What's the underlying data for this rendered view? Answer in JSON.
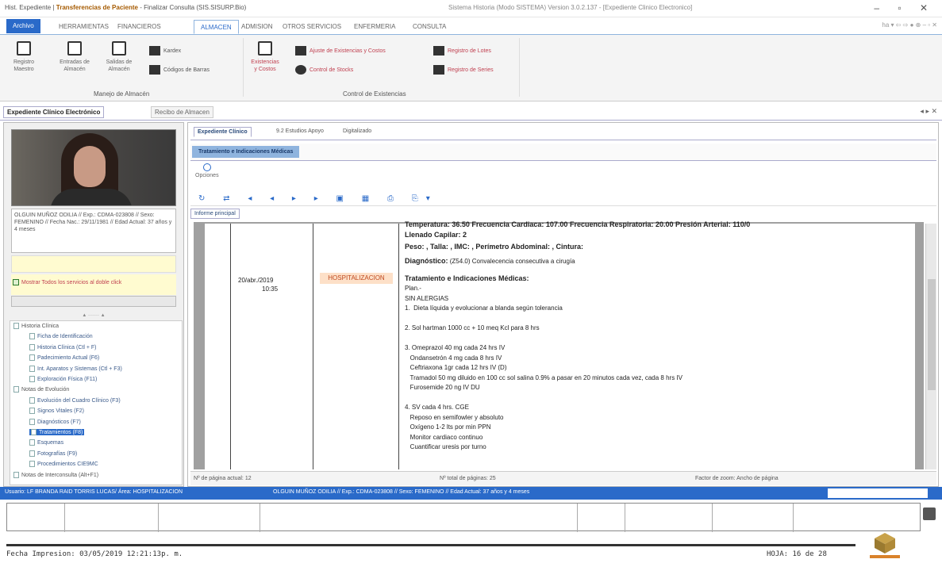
{
  "titlebar": {
    "left_prefix": "Hist. Expediente |",
    "left_bold": "Transferencias de Paciente",
    "left_suffix": "- Finalizar Consulta (SIS.SISURP.Bio)",
    "center": "Sistema Historia (Modo SISTEMA) Version 3.0.2.137 - [Expediente Clinico Electronico]",
    "controls": "– ▫ ✕"
  },
  "menubar": {
    "tabs": [
      "Archivo",
      "HERRAMIENTAS",
      "FINANCIEROS",
      "ALMACEN",
      "ADMISION",
      "OTROS SERVICIOS",
      "ENFERMERIA",
      "CONSULTA"
    ],
    "active_tab": "ALMACEN",
    "right": "ha ▾ ⇦ ⇨ ● ⊕ – ▫ ✕"
  },
  "ribbon": {
    "group1": {
      "buttons": [
        "Registro Maestro",
        "Entradas de Almacén",
        "Salidas de Almacén"
      ],
      "side": [
        "Kardex",
        "Códigos de Barras"
      ],
      "label": "Manejo de Almacén"
    },
    "group2": {
      "button": "Existencias y Costos",
      "rows": [
        "Ajuste de Existencias y Costos",
        "Control de Stocks",
        "Registro de Lotes",
        "Registro de Series"
      ],
      "label": "Control de Existencias"
    }
  },
  "doctabs": {
    "tab1": "Expediente Clínico Electrónico",
    "tab2": "Recibo de Almacen",
    "arrows": "◂ ▸ ✕"
  },
  "patient": {
    "info": "OLGUIN MUÑOZ ODILIA // Exp.: CDMA-023808 // Sexo: FEMENINO // Fecha Nac.: 29/11/1981 // Edad Actual: 37 años y 4 meses",
    "show_all": "Mostrar Todos los servicios al doble click"
  },
  "tree": {
    "items": [
      {
        "label": "Historia Clínica",
        "level": 0
      },
      {
        "label": "Ficha de Identificación",
        "level": 1
      },
      {
        "label": "Historia Clínica (Ctl + F)",
        "level": 1
      },
      {
        "label": "Padecimiento Actual (F6)",
        "level": 1
      },
      {
        "label": "Int. Aparatos y Sistemas (Ctl + F3)",
        "level": 1
      },
      {
        "label": "Exploración Física (F11)",
        "level": 1
      },
      {
        "label": "Notas de Evolución",
        "level": 0
      },
      {
        "label": "Evolución del Cuadro Clínico (F3)",
        "level": 1
      },
      {
        "label": "Signos Vitales (F2)",
        "level": 1
      },
      {
        "label": "Diagnósticos (F7)",
        "level": 1
      },
      {
        "label": "Tratamientos (F8)",
        "level": 1,
        "selected": true
      },
      {
        "label": "Esquemas",
        "level": 1
      },
      {
        "label": "Fotografías (F9)",
        "level": 1
      },
      {
        "label": "Procedimientos CIE9MC",
        "level": 1
      },
      {
        "label": "Notas de Interconsulta (Alt+F1)",
        "level": 0
      }
    ]
  },
  "right": {
    "tabs": [
      "Expediente Clínico",
      "9.2 Estudios Apoyo",
      "Digitalizado"
    ],
    "subtab": "Tratamiento e Indicaciones Médicas",
    "options_label": "Opciones",
    "toolbar": "↻ ⇄ ◂ ◂ ▸ ▸ ▣ ▦ ⎙ ⎘▾",
    "informe_tab": "Informe principal"
  },
  "document": {
    "date": "20/abr./2019",
    "time": "10:35",
    "service": "HOSPITALIZACION",
    "line_top": "Temperatura: 36.50  Frecuencia Cardiaca: 107.00  Frecuencia Respiratoria: 20.00  Presión Arterial: 110/0",
    "llenado": "Llenado Capilar: 2",
    "peso": "Peso: , Talla: , IMC: , Perímetro Abdominal: , Cintura:",
    "diag_label": "Diagnóstico:",
    "diag_value": "(Z54.0) Convalecencia consecutiva a cirugía",
    "tx_title": "Tratamiento e Indicaciones Médicas:",
    "lines": [
      "Plan.-",
      "SIN ALERGIAS",
      "1.  Dieta líquida y evolucionar a blanda según tolerancia",
      "",
      "2. Sol hartman 1000 cc + 10 meq Kcl para 8 hrs",
      "",
      "3. Omeprazol 40 mg cada 24 hrs IV",
      "   Ondansetrón 4 mg cada 8 hrs IV",
      "   Ceftriaxona 1gr cada 12 hrs IV (D)",
      "   Tramadol 50 mg diluido en 100 cc sol salina 0.9% a pasar en 20 minutos cada vez, cada 8 hrs IV",
      "   Furosemide 20 ng IV DU",
      "",
      "4. SV cada 4 hrs. CGE",
      "   Reposo en semifowler y absoluto",
      "   Oxígeno 1-2 lts por min PPN",
      "   Monitor cardiaco continuo",
      "   Cuantificar uresis por turno"
    ]
  },
  "pagebar": {
    "current": "Nº de página actual: 12",
    "total": "Nº total de páginas: 25",
    "zoom": "Factor de zoom: Ancho de página"
  },
  "statusbar": {
    "user": "Usuario: LF BRANDA RAID TORRIS LUCAS/ Área: HOSPITALIZACION",
    "patient": "OLGUIN MUÑOZ ODILIA // Exp.: CDMA-023808 // Sexo: FEMENINO // Edad Actual: 37 años y 4 meses"
  },
  "footer": {
    "print_date": "Fecha Impresion: 03/05/2019 12:21:13p. m.",
    "sheet": "HOJA: 16 de 28"
  }
}
